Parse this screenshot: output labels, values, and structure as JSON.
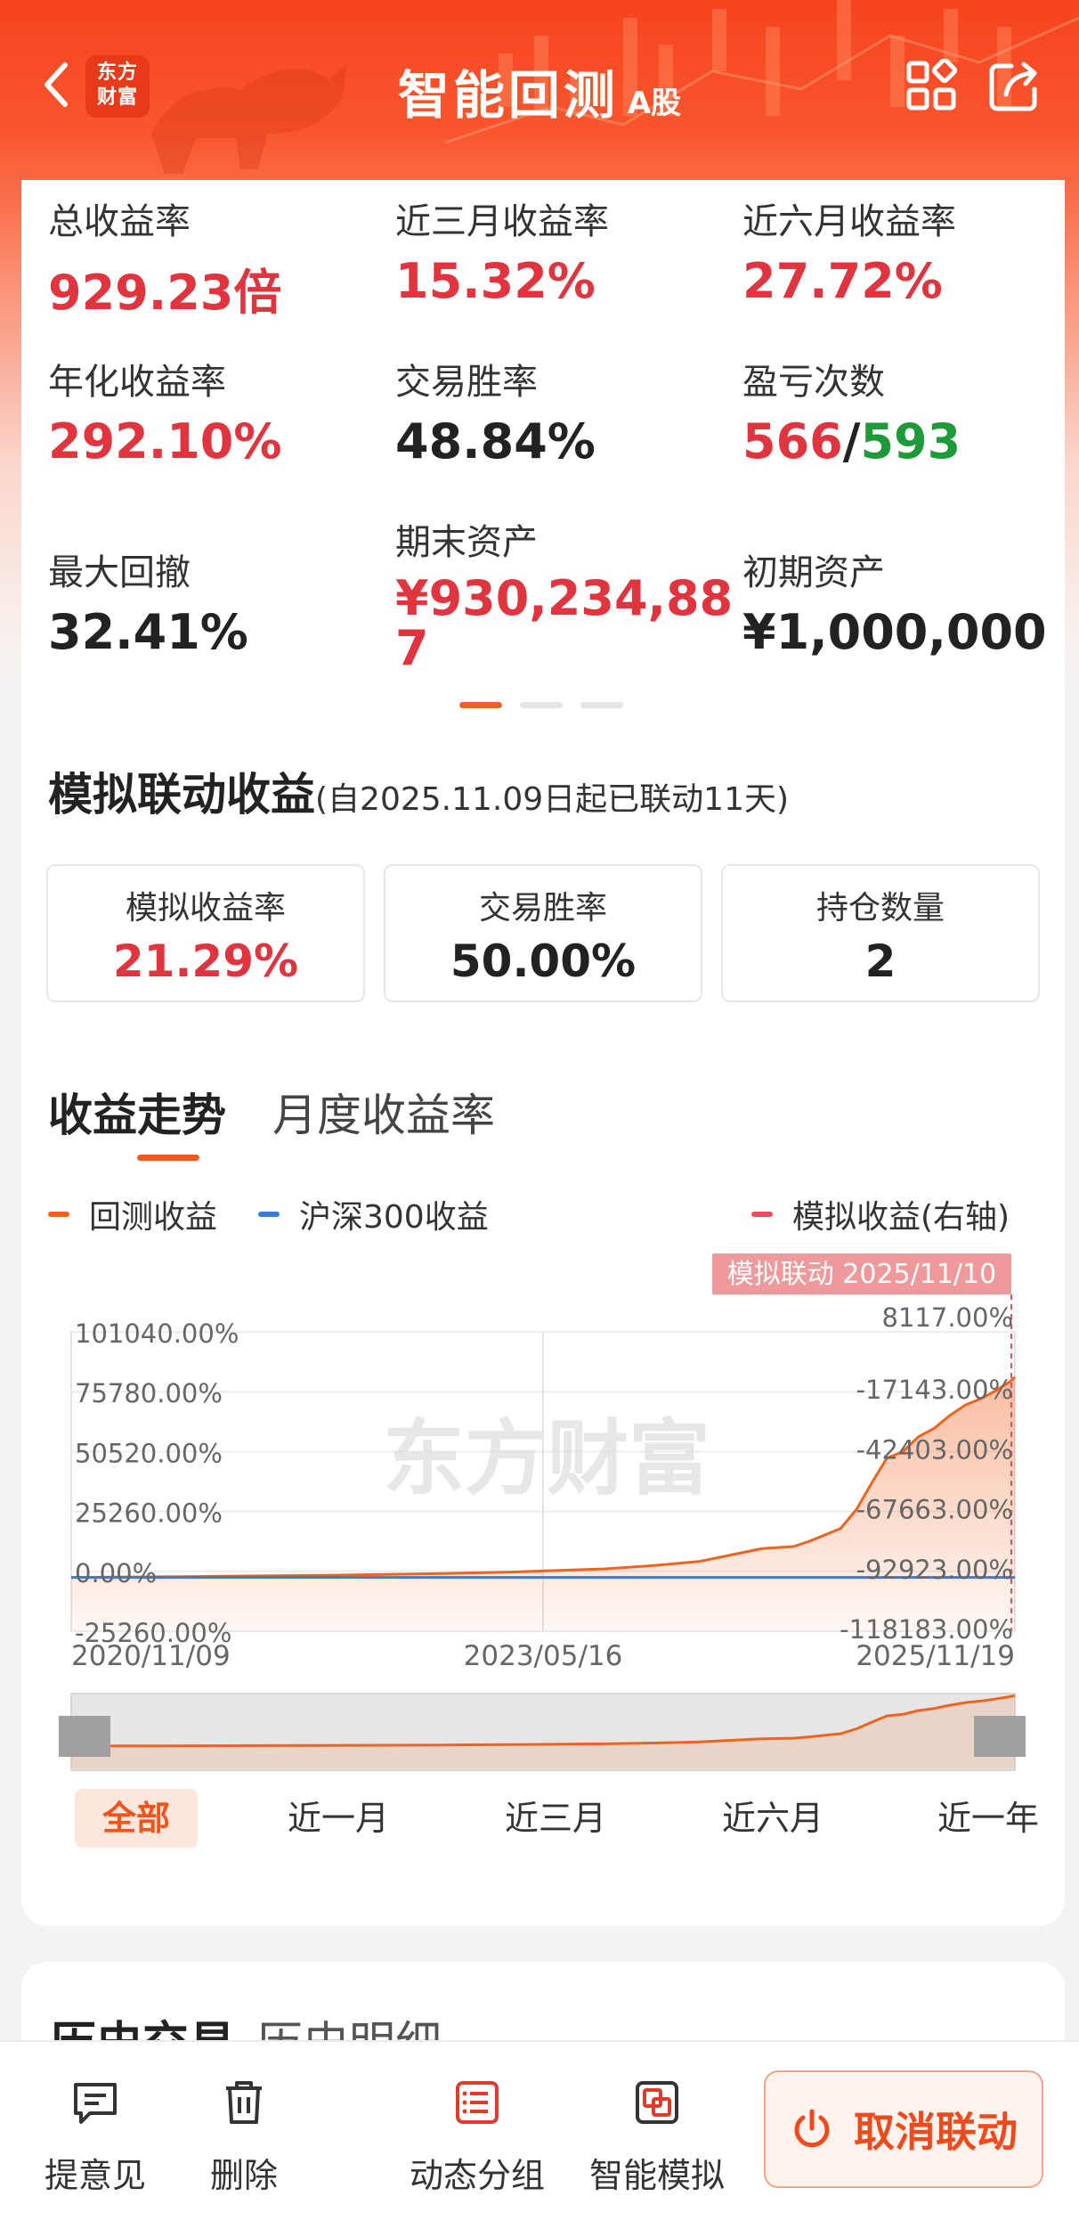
{
  "header": {
    "logo_line1": "东方",
    "logo_line2": "财富",
    "title": "智能回测",
    "title_sub": "A股"
  },
  "stats": [
    {
      "label": "总收益率",
      "value": "929.23倍",
      "color": "red"
    },
    {
      "label": "近三月收益率",
      "value": "15.32%",
      "color": "red"
    },
    {
      "label": "近六月收益率",
      "value": "27.72%",
      "color": "red"
    },
    {
      "label": "年化收益率",
      "value": "292.10%",
      "color": "red"
    },
    {
      "label": "交易胜率",
      "value": "48.84%",
      "color": "dark"
    },
    {
      "label": "盈亏次数",
      "value_win": "566",
      "value_sep": "/",
      "value_loss": "593"
    },
    {
      "label": "最大回撤",
      "value": "32.41%",
      "color": "dark"
    },
    {
      "label": "期末资产",
      "value_line1": "¥930,234,88",
      "value_line2": "7",
      "color": "red"
    },
    {
      "label": "初期资产",
      "value": "¥1,000,000",
      "color": "dark"
    }
  ],
  "carousel": {
    "active_index": 0,
    "count": 3
  },
  "sim": {
    "title": "模拟联动收益",
    "subtitle": "(自2025.11.09日起已联动11天)",
    "boxes": [
      {
        "label": "模拟收益率",
        "value": "21.29%",
        "color": "red"
      },
      {
        "label": "交易胜率",
        "value": "50.00%",
        "color": "dark"
      },
      {
        "label": "持仓数量",
        "value": "2",
        "color": "dark"
      }
    ]
  },
  "chart_tabs": [
    "收益走势",
    "月度收益率"
  ],
  "legend": {
    "backtest": "回测收益",
    "hs300": "沪深300收益",
    "sim": "模拟收益(右轴)"
  },
  "chart_data": {
    "type": "line",
    "title": "",
    "watermark": "东方财富",
    "marker_label": "模拟联动 2025/11/10",
    "x_ticks": [
      "2020/11/09",
      "2023/05/16",
      "2025/11/19"
    ],
    "left_axis_ticks": [
      "101040.00%",
      "75780.00%",
      "50520.00%",
      "25260.00%",
      "0.00%",
      "-25260.00%"
    ],
    "right_axis_ticks": [
      "8117.00%",
      "-17143.00%",
      "-42403.00%",
      "-67663.00%",
      "-92923.00%",
      "-118183.00%"
    ],
    "ylim": [
      -25260,
      101040
    ],
    "colors": {
      "backtest": "#f0631f",
      "hs300": "#3a7bd5",
      "sim": "#e05060"
    },
    "series": [
      {
        "name": "回测收益",
        "points": [
          [
            "2020/11/09",
            0
          ],
          [
            "2021/03",
            200
          ],
          [
            "2021/07",
            400
          ],
          [
            "2021/11",
            700
          ],
          [
            "2022/03",
            1000
          ],
          [
            "2022/07",
            1400
          ],
          [
            "2022/11",
            1900
          ],
          [
            "2023/03",
            2500
          ],
          [
            "2023/05",
            3000
          ],
          [
            "2023/09",
            4000
          ],
          [
            "2023/12",
            5500
          ],
          [
            "2024/03",
            7500
          ],
          [
            "2024/05",
            10500
          ],
          [
            "2024/07",
            13500
          ],
          [
            "2024/09",
            14500
          ],
          [
            "2024/10",
            17000
          ],
          [
            "2024/11",
            20000
          ],
          [
            "2024/12",
            23000
          ],
          [
            "2025/01",
            32000
          ],
          [
            "2025/02",
            45000
          ],
          [
            "2025/03",
            56000
          ],
          [
            "2025/04",
            59000
          ],
          [
            "2025/05",
            66000
          ],
          [
            "2025/06",
            70000
          ],
          [
            "2025/07",
            76000
          ],
          [
            "2025/08",
            81000
          ],
          [
            "2025/09",
            84000
          ],
          [
            "2025/10",
            88000
          ],
          [
            "2025/11/10",
            92000
          ],
          [
            "2025/11/19",
            94000
          ]
        ]
      },
      {
        "name": "沪深300收益",
        "points": [
          [
            "2020/11/09",
            0
          ],
          [
            "2023/05/16",
            -20
          ],
          [
            "2025/11/19",
            10
          ]
        ]
      }
    ]
  },
  "ranges": [
    "全部",
    "近一月",
    "近三月",
    "近六月",
    "近一年"
  ],
  "history": {
    "title": "历史交易",
    "other": "历史明细"
  },
  "bottom_bar": {
    "feedback": "提意见",
    "delete": "删除",
    "group": "动态分组",
    "simulate": "智能模拟",
    "cancel": "取消联动"
  }
}
